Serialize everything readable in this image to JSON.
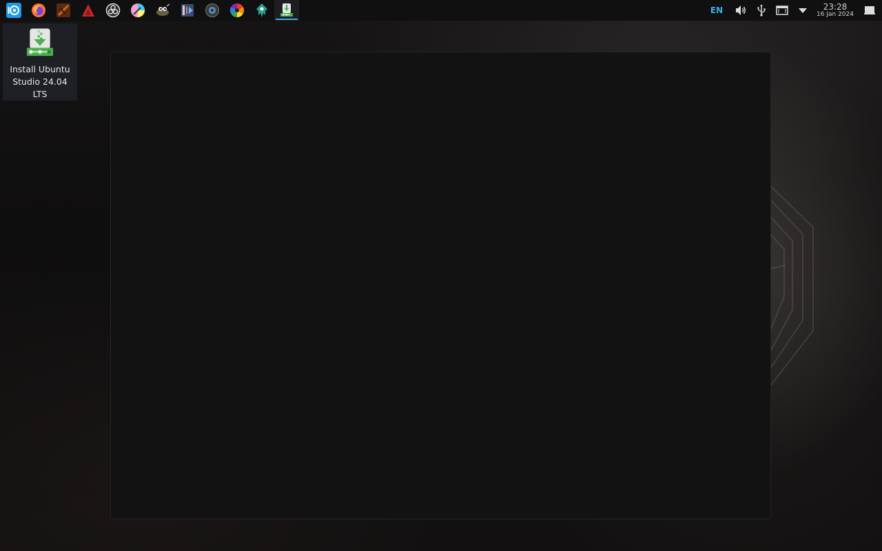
{
  "panel": {
    "launchers": [
      {
        "name": "ubuntu-studio-menu-icon",
        "color": "#1d99f3"
      },
      {
        "name": "firefox-icon",
        "color": "#ff7139"
      },
      {
        "name": "ardour-icon",
        "color": "#8a3a12"
      },
      {
        "name": "carla-icon",
        "color": "#d8322f"
      },
      {
        "name": "obs-studio-icon",
        "color": "#dddddd"
      },
      {
        "name": "krita-icon",
        "color": "#f59fd4"
      },
      {
        "name": "gimp-icon",
        "color": "#8a7a5c"
      },
      {
        "name": "kdenlive-icon",
        "color": "#5a6fa8"
      },
      {
        "name": "mixxx-icon",
        "color": "#5a8fbf"
      },
      {
        "name": "darktable-icon",
        "color": "#e53935"
      },
      {
        "name": "inkscape-icon",
        "color": "#2a9d8f"
      },
      {
        "name": "installer-icon",
        "color": "#4caf50",
        "active": true
      }
    ],
    "tray": {
      "language": "EN",
      "volume_icon": "speaker-icon",
      "usb_icon": "usb-icon",
      "notifications_icon": "display-icon",
      "expand_icon": "triangle-down-icon",
      "clock": {
        "time": "23:28",
        "date": "16 Jan 2024"
      },
      "show_desktop_icon": "show-desktop-icon"
    }
  },
  "desktop": {
    "icons": [
      {
        "label": "Install Ubuntu Studio 24.04 LTS",
        "icon": "installer-icon"
      }
    ]
  },
  "colors": {
    "accent": "#3daee9",
    "panel_bg": "#101010",
    "window_bg": "#121213"
  }
}
